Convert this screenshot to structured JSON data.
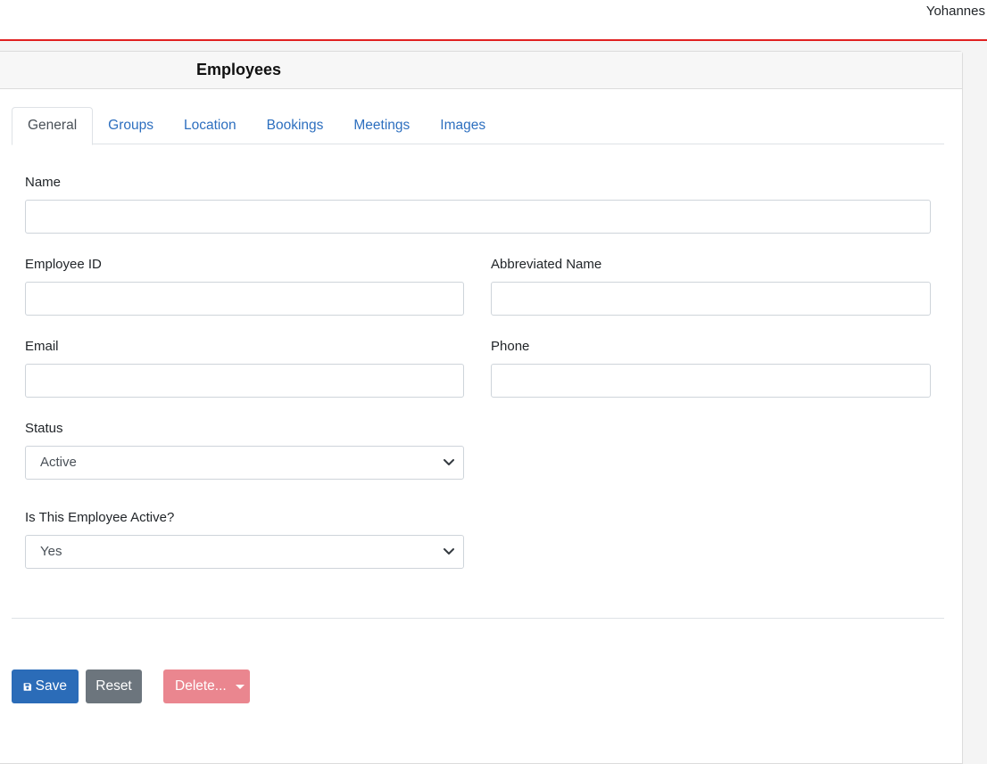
{
  "header": {
    "user_name": "Yohannes"
  },
  "card": {
    "title": "Employees"
  },
  "tabs": [
    {
      "label": "General",
      "active": true
    },
    {
      "label": "Groups",
      "active": false
    },
    {
      "label": "Location",
      "active": false
    },
    {
      "label": "Bookings",
      "active": false
    },
    {
      "label": "Meetings",
      "active": false
    },
    {
      "label": "Images",
      "active": false
    }
  ],
  "form": {
    "name": {
      "label": "Name",
      "value": ""
    },
    "employee_id": {
      "label": "Employee ID",
      "value": ""
    },
    "abbreviated_name": {
      "label": "Abbreviated Name",
      "value": ""
    },
    "email": {
      "label": "Email",
      "value": ""
    },
    "phone": {
      "label": "Phone",
      "value": ""
    },
    "status": {
      "label": "Status",
      "selected": "Active"
    },
    "is_active": {
      "label": "Is This Employee Active?",
      "selected": "Yes"
    }
  },
  "buttons": {
    "save": {
      "label": "Save",
      "icon": "floppy-disk-icon"
    },
    "reset": {
      "label": "Reset"
    },
    "delete": {
      "label": "Delete..."
    }
  },
  "colors": {
    "accent_line": "#e02020",
    "primary": "#2b6cb8",
    "secondary": "#6c757d",
    "danger_disabled": "#ea868f",
    "tab_link": "#2d6fbf"
  }
}
